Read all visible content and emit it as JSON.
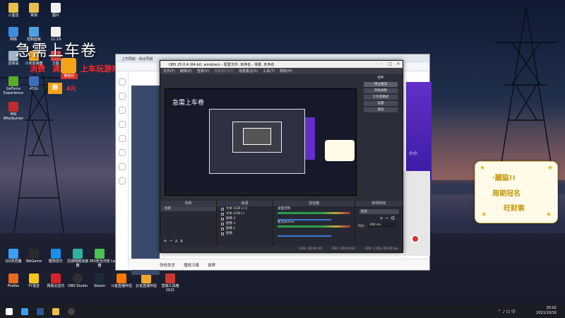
{
  "overlay": {
    "main_title": "急需上车卷",
    "line_part1": "消费",
    "line_part2": "满",
    "line_part3": "上车玩游戏",
    "badge_label": "推荐价",
    "coupon": "券",
    "coupon_suffix": "4元"
  },
  "desktop_icons": [
    {
      "label": "小蓝店"
    },
    {
      "label": "常用"
    },
    {
      "label": "图片"
    },
    {
      "label": "网络"
    },
    {
      "label": "控制面板"
    },
    {
      "label": "12.19"
    },
    {
      "label": "回收站"
    },
    {
      "label": "小米加速器"
    },
    {
      "label": "万能"
    },
    {
      "label": "GeForce Experience"
    },
    {
      "label": "451k"
    },
    {
      "label": "MSI Afterburner"
    },
    {
      "label": "QQ浏览器"
    },
    {
      "label": "WeGame"
    },
    {
      "label": "酷狗音乐"
    },
    {
      "label": "迅游网络加速器"
    },
    {
      "label": "360安全浏览器"
    },
    {
      "label": "Launcher 快捷方式"
    },
    {
      "label": "Firefox"
    },
    {
      "label": "YY语音"
    },
    {
      "label": "网易云音乐"
    },
    {
      "label": "OBS Studio"
    },
    {
      "label": "Steam"
    },
    {
      "label": "斗鱼直播伴侣"
    },
    {
      "label": "云雀直播伴侣"
    },
    {
      "label": "营销工具箱 2021"
    }
  ],
  "browser": {
    "tab_title": "上司导航 · 综合导航",
    "bottom_items": [
      "你他发言",
      "播放冷暴",
      "录屏"
    ],
    "side_label": "小小"
  },
  "obs": {
    "window_title": "OBS 25.0.4 (64-bit, windows) - 配置文件: 未命名 - 场景: 未命名",
    "menu": [
      "文件(F)",
      "编辑(E)",
      "查看(V)",
      "停靠窗口(D)",
      "场景集合(S)",
      "工具(T)",
      "帮助(H)"
    ],
    "control_buttons": [
      "控件",
      "停止推流",
      "开始录制",
      "工作室模式",
      "设置",
      "退出"
    ],
    "docks": {
      "scenes": "场景",
      "sources": "来源",
      "mixer": "混音器",
      "transitions": "转场特效"
    },
    "scene_items": [
      "场景"
    ],
    "source_items": [
      "文本 (GDI+) 2",
      "文本 (GDI+)",
      "图像 4",
      "图像 3",
      "图像 2",
      "图像"
    ],
    "mixer_channels": [
      "桌面音频",
      "麦克风/Aux"
    ],
    "transition_value": "淡出",
    "duration_label": "时长",
    "duration_value": "300 ms",
    "status": [
      "LIVE: 00:00:00",
      "REC: 00:00:00",
      "CPU: 1.0%, 60.00 fps"
    ]
  },
  "note": {
    "line1": "·臓脇!!",
    "line2": "周期冠名",
    "line3": "旺财紫"
  },
  "tray": {
    "time": "20:02",
    "date": "2021/10/16"
  },
  "colors": {
    "accent_red": "#ff2a2a",
    "coupon_orange": "#f4a21a",
    "obs_bg": "#2b2e38",
    "panel_purple": "#6230c8"
  }
}
